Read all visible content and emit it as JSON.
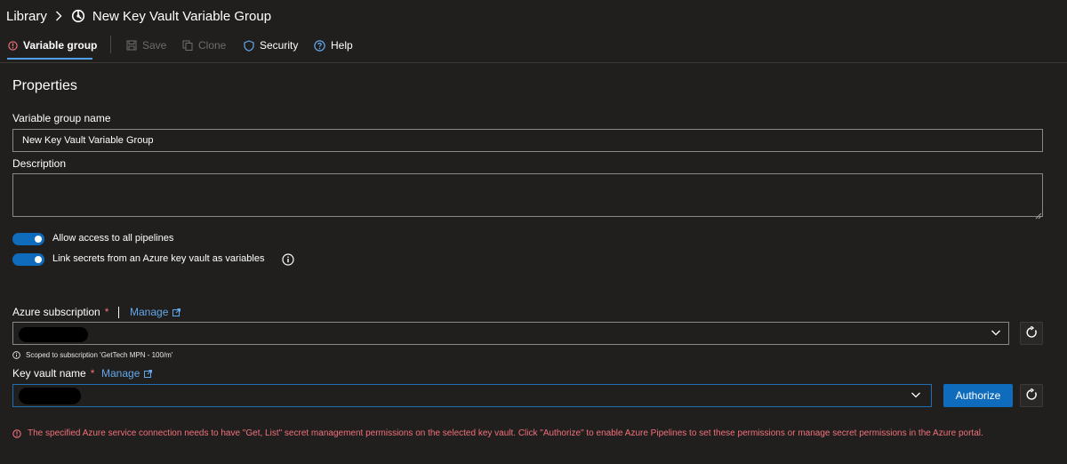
{
  "breadcrumb": {
    "root": "Library",
    "current": "New Key Vault Variable Group"
  },
  "toolbar": {
    "variable_group": "Variable group",
    "save": "Save",
    "clone": "Clone",
    "security": "Security",
    "help": "Help"
  },
  "properties": {
    "title": "Properties",
    "name_label": "Variable group name",
    "name_value": "New Key Vault Variable Group",
    "description_label": "Description",
    "description_value": "",
    "allow_access_label": "Allow access to all pipelines",
    "allow_access_on": true,
    "link_secrets_label": "Link secrets from an Azure key vault as variables",
    "link_secrets_on": true
  },
  "azure": {
    "subscription_label": "Azure subscription",
    "required_mark": "*",
    "manage_label": "Manage",
    "scope_hint": "Scoped to subscription 'GetTech MPN - 100/m'",
    "keyvault_label": "Key vault name",
    "keyvault_manage_label": "Manage",
    "authorize_label": "Authorize",
    "error_message": "The specified Azure service connection needs to have \"Get, List\" secret management permissions on the selected key vault. Click \"Authorize\" to enable Azure Pipelines to set these permissions or manage secret permissions in the Azure portal."
  },
  "colors": {
    "background": "#201f1e",
    "accent": "#0f6cbd",
    "link": "#62a8ea",
    "error": "#f1707b"
  },
  "icons": {
    "chevron": "chevron-right-icon",
    "variable_group": "variable-group-icon",
    "warning": "error-circle-icon",
    "save": "save-icon",
    "clone": "clone-icon",
    "security": "shield-icon",
    "help": "help-icon",
    "info": "info-icon",
    "external": "external-link-icon",
    "dropdown": "chevron-down-icon",
    "refresh": "refresh-icon"
  }
}
